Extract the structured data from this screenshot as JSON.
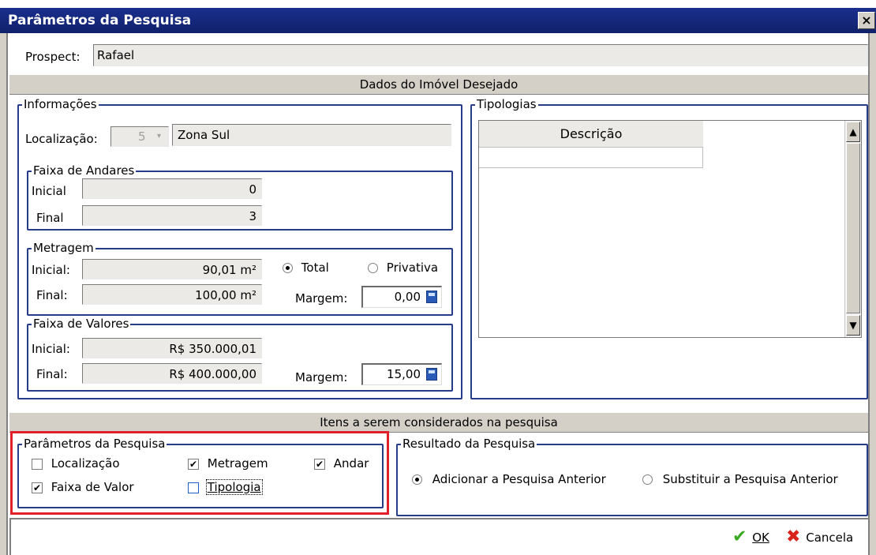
{
  "window": {
    "title": "Parâmetros da Pesquisa",
    "close_glyph": "×"
  },
  "prospect": {
    "label": "Prospect:",
    "value": "Rafael"
  },
  "imovel_header": "Dados do Imóvel Desejado",
  "informacoes": {
    "title": "Informações",
    "localizacao_label": "Localização:",
    "localizacao_code": "5",
    "localizacao_name": "Zona Sul",
    "andares": {
      "title": "Faixa de Andares",
      "inicial_label": "Inicial",
      "inicial_value": "0",
      "final_label": "Final",
      "final_value": "3"
    },
    "metragem": {
      "title": "Metragem",
      "inicial_label": "Inicial:",
      "inicial_value": "90,01  m²",
      "final_label": "Final:",
      "final_value": "100,00  m²",
      "option_total": "Total",
      "option_privativa": "Privativa",
      "selected": "Total",
      "margem_label": "Margem:",
      "margem_value": "0,00"
    },
    "valores": {
      "title": "Faixa de Valores",
      "inicial_label": "Inicial:",
      "inicial_value": "R$ 350.000,01",
      "final_label": "Final:",
      "final_value": "R$ 400.000,00",
      "margem_label": "Margem:",
      "margem_value": "15,00"
    }
  },
  "tipologias": {
    "title": "Tipologias",
    "column": "Descrição"
  },
  "itens_header": "Itens a serem considerados na pesquisa",
  "parametros": {
    "title": "Parâmetros da Pesquisa",
    "items": [
      {
        "label": "Localização",
        "checked": false
      },
      {
        "label": "Metragem",
        "checked": true
      },
      {
        "label": "Andar",
        "checked": true
      },
      {
        "label": "Faixa de Valor",
        "checked": true
      },
      {
        "label": "Tipologia",
        "checked": false
      }
    ],
    "highlight_color": "#e0202a"
  },
  "resultado": {
    "title": "Resultado da Pesquisa",
    "option_add": "Adicionar a Pesquisa Anterior",
    "option_replace": "Substituir a Pesquisa Anterior",
    "selected": "Adicionar a Pesquisa Anterior"
  },
  "buttons": {
    "ok": "OK",
    "cancel": "Cancela"
  },
  "colors": {
    "title_bar": "#10206a",
    "group_border": "#283c8c",
    "ok_green": "#3aa820",
    "cancel_red": "#d8241c"
  }
}
